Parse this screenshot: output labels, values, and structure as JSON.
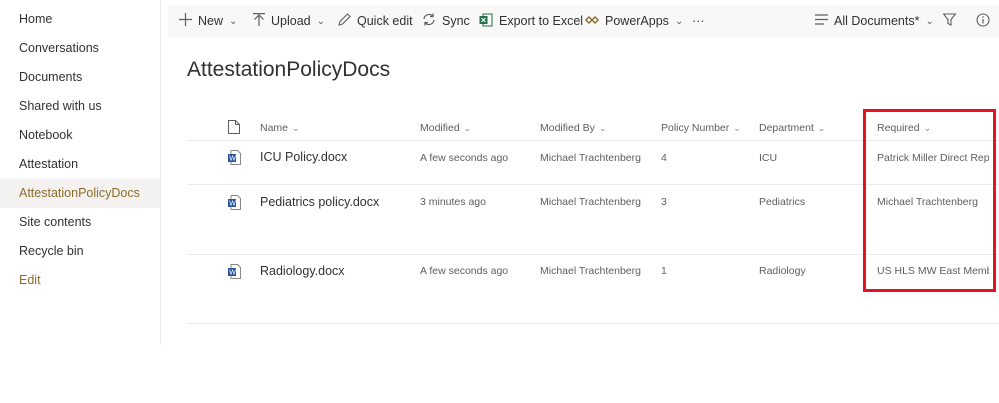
{
  "nav": {
    "items": [
      "Home",
      "Conversations",
      "Documents",
      "Shared with us",
      "Notebook",
      "Attestation",
      "AttestationPolicyDocs",
      "Site contents",
      "Recycle bin"
    ],
    "edit_label": "Edit",
    "selected": "AttestationPolicyDocs"
  },
  "commandbar": {
    "new": "New",
    "upload": "Upload",
    "quick_edit": "Quick edit",
    "sync": "Sync",
    "export": "Export to Excel",
    "powerapps": "PowerApps",
    "more": "···",
    "view": "All Documents*"
  },
  "library_title": "AttestationPolicyDocs",
  "columns": {
    "name": "Name",
    "modified": "Modified",
    "modified_by": "Modified By",
    "policy_number": "Policy Number",
    "department": "Department",
    "required": "Required"
  },
  "rows": [
    {
      "name": "ICU Policy.docx",
      "modified": "A few seconds ago",
      "modified_by": "Michael Trachtenberg",
      "policy_number": "4",
      "department": "ICU",
      "required": "Patrick Miller Direct Repor"
    },
    {
      "name": "Pediatrics policy.docx",
      "modified": "3 minutes ago",
      "modified_by": "Michael Trachtenberg",
      "policy_number": "3",
      "department": "Pediatrics",
      "required": "Michael Trachtenberg"
    },
    {
      "name": "Radiology.docx",
      "modified": "A few seconds ago",
      "modified_by": "Michael Trachtenberg",
      "policy_number": "1",
      "department": "Radiology",
      "required": "US HLS MW East Members"
    }
  ],
  "colors": {
    "accent": "#8a6d2b",
    "highlight": "#e81123",
    "word_blue": "#2b579a"
  },
  "icons": [
    "plus-icon",
    "upload-arrow-icon",
    "pencil-icon",
    "sync-icon",
    "excel-icon",
    "powerapps-icon",
    "list-view-icon",
    "filter-icon",
    "info-icon",
    "document-icon",
    "word-file-icon",
    "chevron-down-icon"
  ]
}
